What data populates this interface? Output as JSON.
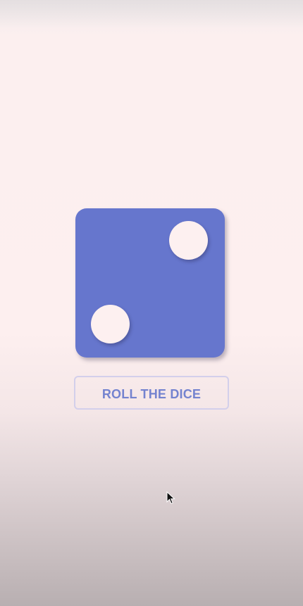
{
  "die": {
    "face_value": 2,
    "color": "#6676cd",
    "pip_color": "#fdf0f0"
  },
  "roll_button": {
    "label": "ROLL THE DICE",
    "text_color": "#7483cf",
    "border_color": "#d3cfeb"
  },
  "background": {
    "top_color": "#fdefef",
    "bottom_color": "#b8afb1"
  },
  "icons": {
    "cursor": "mouse-pointer-icon"
  }
}
